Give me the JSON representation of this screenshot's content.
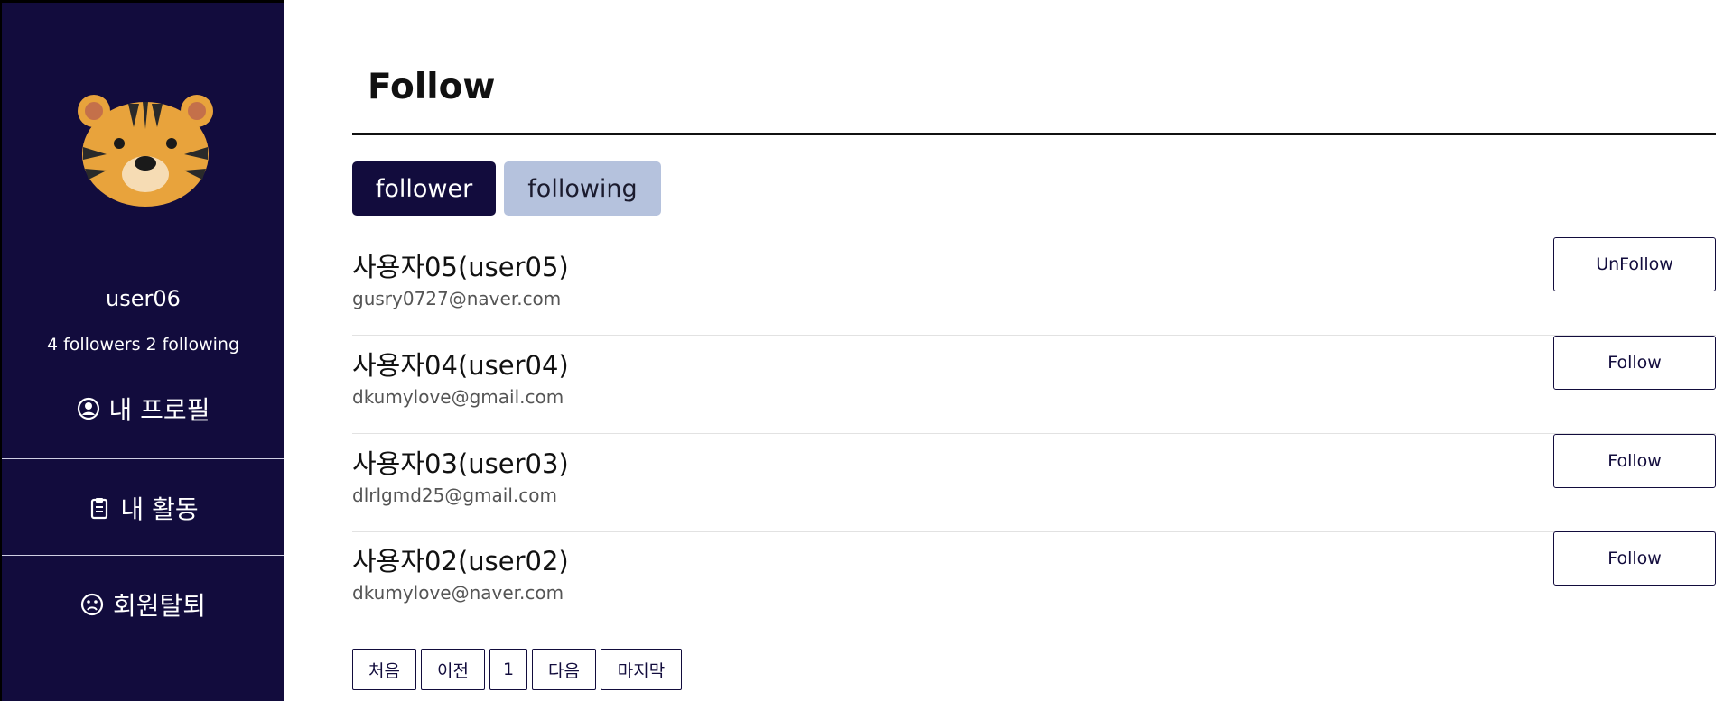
{
  "sidebar": {
    "username": "user06",
    "followers_count": "4",
    "followers_label": "followers",
    "following_count": "2",
    "following_label": "following",
    "menu": [
      {
        "label": "내 프로필",
        "icon": "user-circle-icon"
      },
      {
        "label": "내 활동",
        "icon": "clipboard-icon"
      },
      {
        "label": "회원탈퇴",
        "icon": "frown-icon"
      }
    ]
  },
  "main": {
    "title": "Follow",
    "tabs": [
      {
        "label": "follower",
        "active": true
      },
      {
        "label": "following",
        "active": false
      }
    ],
    "users": [
      {
        "name": "사용자05(user05)",
        "email": "gusry0727@naver.com",
        "action": "UnFollow"
      },
      {
        "name": "사용자04(user04)",
        "email": "dkumylove@gmail.com",
        "action": "Follow"
      },
      {
        "name": "사용자03(user03)",
        "email": "dlrlgmd25@gmail.com",
        "action": "Follow"
      },
      {
        "name": "사용자02(user02)",
        "email": "dkumylove@naver.com",
        "action": "Follow"
      }
    ],
    "pagination": [
      "처음",
      "이전",
      "1",
      "다음",
      "마지막"
    ]
  },
  "colors": {
    "sidebar_bg": "#120c3d",
    "tab_active_bg": "#120c3d",
    "tab_inactive_bg": "#b5c2dd",
    "tiger_orange": "#e8a33c"
  }
}
